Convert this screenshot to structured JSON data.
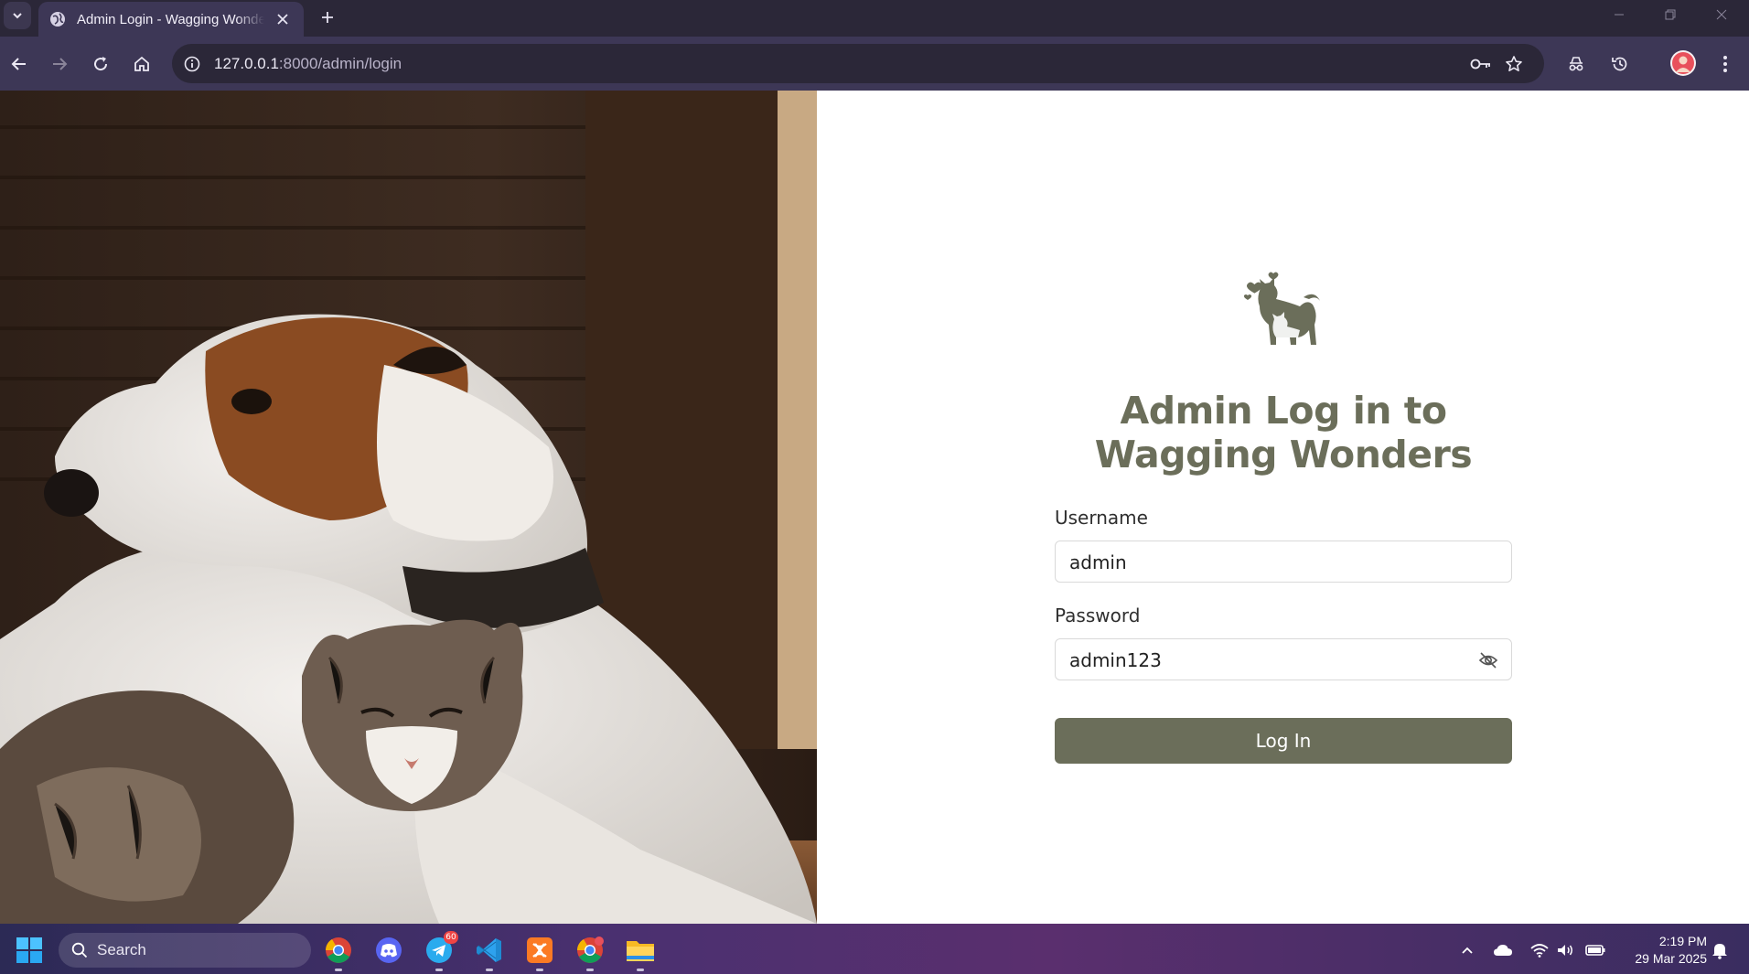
{
  "browser": {
    "tab_title": "Admin Login - Wagging Wonders",
    "url_host": "127.0.0.1",
    "url_rest": ":8000/admin/login"
  },
  "login": {
    "heading_line1": "Admin Log in to",
    "heading_line2": "Wagging Wonders",
    "username_label": "Username",
    "username_value": "admin",
    "password_label": "Password",
    "password_value": "admin123",
    "submit_label": "Log In",
    "accent_color": "#6b6e5a"
  },
  "taskbar": {
    "search_label": "Search",
    "telegram_badge": "60",
    "time": "2:19 PM",
    "date": "29 Mar 2025"
  },
  "icons": [
    "tab-list-icon",
    "globe-icon",
    "close-icon",
    "plus-icon",
    "minimize-icon",
    "restore-icon",
    "back-icon",
    "forward-icon",
    "reload-icon",
    "home-icon",
    "info-icon",
    "key-icon",
    "star-icon",
    "extensions-icon",
    "history-icon",
    "kebab-menu-icon",
    "eye-off-icon",
    "windows-start-icon",
    "search-icon",
    "chrome-icon",
    "discord-icon",
    "telegram-icon",
    "vscode-icon",
    "xampp-icon",
    "folder-icon",
    "chevron-up-icon",
    "cloud-icon",
    "wifi-icon",
    "volume-icon",
    "battery-icon",
    "notification-icon"
  ]
}
